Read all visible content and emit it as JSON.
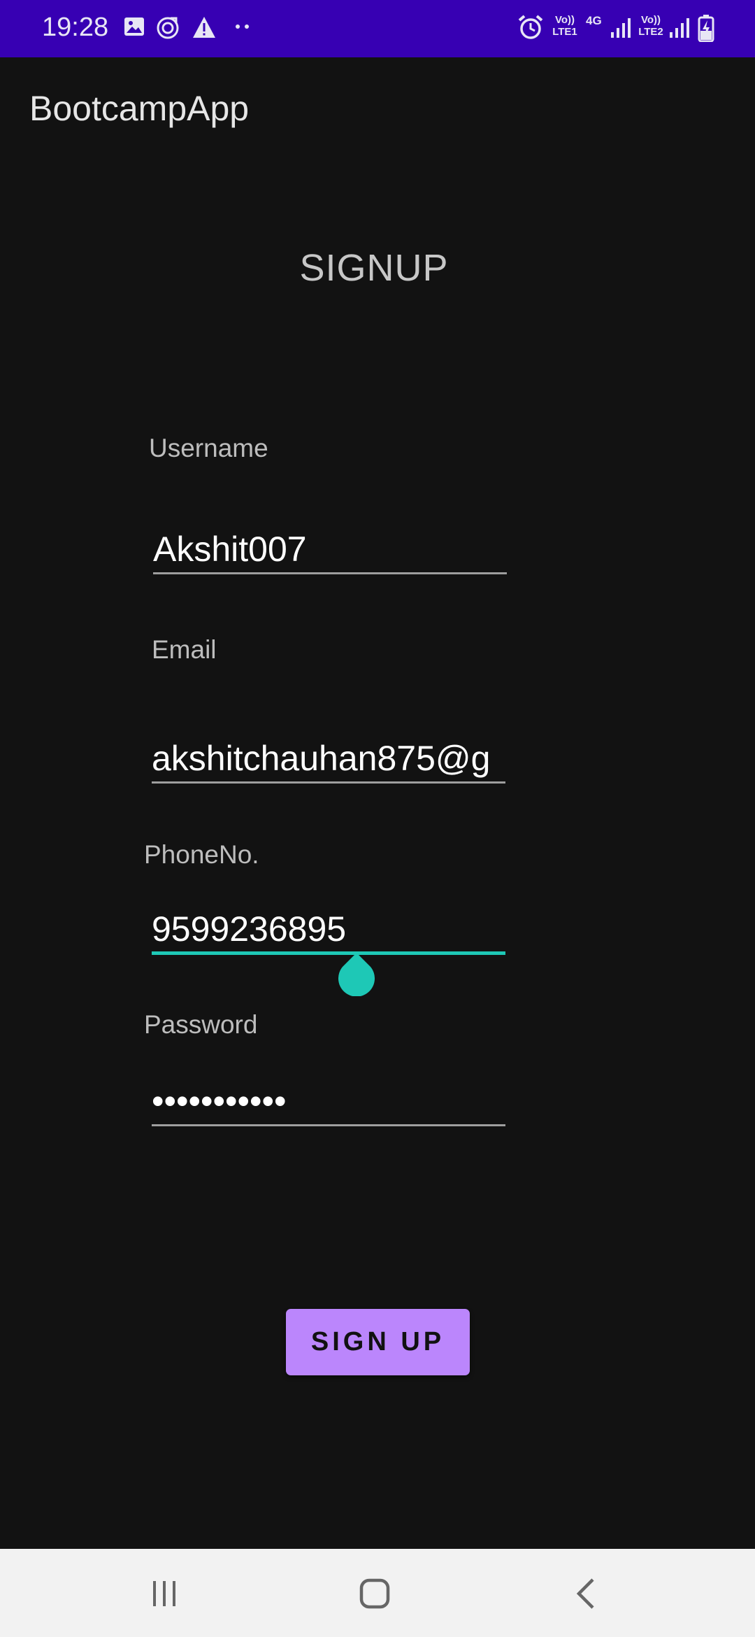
{
  "status_bar": {
    "time": "19:28",
    "left_icons": [
      "image-icon",
      "sync-icon",
      "warning-icon",
      "more-dots-icon"
    ],
    "right_icons": [
      "alarm-icon",
      "volte-sim1-icon",
      "4g-data-icon",
      "signal-sim1-icon",
      "volte-sim2-icon",
      "signal-sim2-icon",
      "battery-charging-icon"
    ],
    "volte1_label": "Vo)) LTE1",
    "data_label": "4G",
    "volte2_label": "Vo)) LTE2",
    "background_color": "#3700B3"
  },
  "app_bar": {
    "title": "BootcampApp"
  },
  "form": {
    "title": "SIGNUP",
    "username": {
      "label": "Username",
      "value": "Akshit007"
    },
    "email": {
      "label": "Email",
      "value": "akshitchauhan875@g"
    },
    "phone": {
      "label": "PhoneNo.",
      "value": "9599236895"
    },
    "password": {
      "label": "Password",
      "value": "•••••••••••"
    },
    "focus_color": "#1EC8B6",
    "submit_label": "SIGN UP",
    "submit_color": "#BB86FC"
  },
  "nav_bar": {
    "buttons": [
      "recent-apps-icon",
      "home-icon",
      "back-icon"
    ]
  }
}
